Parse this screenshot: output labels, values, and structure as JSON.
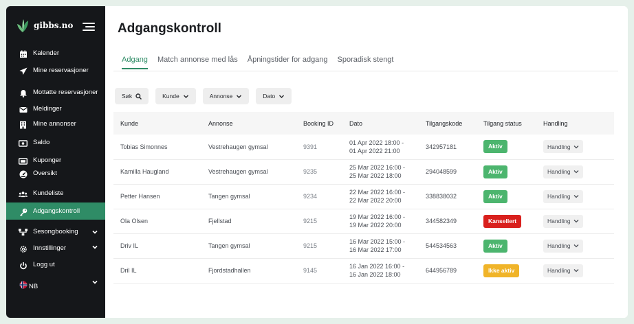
{
  "sidebar": {
    "brand": "gibbs.no",
    "items": [
      {
        "label": "Kalender",
        "icon": "calendar-icon"
      },
      {
        "label": "Mine reservasjoner",
        "icon": "paper-plane-icon"
      },
      {
        "label": "Mottatte reservasjoner",
        "icon": "bell-icon"
      },
      {
        "label": "Meldinger",
        "icon": "envelope-icon"
      },
      {
        "label": "Mine annonser",
        "icon": "building-icon"
      },
      {
        "label": "Saldo",
        "icon": "money-icon"
      },
      {
        "label": "Kuponger",
        "icon": "ticket-icon"
      },
      {
        "label": "Oversikt",
        "icon": "gauge-icon"
      },
      {
        "label": "Kundeliste",
        "icon": "users-icon"
      },
      {
        "label": "Adgangskontroll",
        "icon": "key-icon",
        "active": true
      },
      {
        "label": "Sesongbooking",
        "icon": "sitemap-icon",
        "expandable": true
      },
      {
        "label": "Innstillinger",
        "icon": "gear-icon",
        "expandable": true
      },
      {
        "label": "Logg ut",
        "icon": "power-icon"
      },
      {
        "label": "NB",
        "icon": "norway-flag-icon",
        "expandable": true
      }
    ]
  },
  "header": {
    "title": "Adgangskontroll"
  },
  "tabs": [
    {
      "label": "Adgang",
      "active": true
    },
    {
      "label": "Match annonse med lås"
    },
    {
      "label": "Åpningstider for adgang"
    },
    {
      "label": "Sporadisk stengt"
    }
  ],
  "filters": [
    {
      "label": "Søk",
      "icon": "search-icon"
    },
    {
      "label": "Kunde",
      "icon": "chevron-down-icon"
    },
    {
      "label": "Annonse",
      "icon": "chevron-down-icon"
    },
    {
      "label": "Dato",
      "icon": "chevron-down-icon"
    }
  ],
  "table": {
    "columns": [
      "Kunde",
      "Annonse",
      "Booking ID",
      "Dato",
      "Tilgangskode",
      "Tilgang status",
      "Handling"
    ],
    "rows": [
      {
        "kunde": "Tobias Simonnes",
        "annonse": "Vestrehaugen gymsal",
        "booking_id": "9391",
        "dato_from": "01 Apr 2022 18:00 -",
        "dato_to": "01 Apr 2022 21:00",
        "kode": "342957181",
        "status": "Aktiv",
        "status_color": "#4cb56e",
        "handling": "Handling"
      },
      {
        "kunde": "Kamilla Haugland",
        "annonse": "Vestrehaugen gymsal",
        "booking_id": "9235",
        "dato_from": "25 Mar 2022 16:00 -",
        "dato_to": "25 Mar 2022 18:00",
        "kode": "294048599",
        "status": "Aktiv",
        "status_color": "#4cb56e",
        "handling": "Handling"
      },
      {
        "kunde": "Petter Hansen",
        "annonse": "Tangen gymsal",
        "booking_id": "9234",
        "dato_from": "22 Mar 2022 16:00 -",
        "dato_to": "22 Mar 2022 20:00",
        "kode": "338838032",
        "status": "Aktiv",
        "status_color": "#4cb56e",
        "handling": "Handling"
      },
      {
        "kunde": "Ola Olsen",
        "annonse": "Fjellstad",
        "booking_id": "9215",
        "dato_from": "19 Mar 2022 16:00 -",
        "dato_to": "19 Mar 2022 20:00",
        "kode": "344582349",
        "status": "Kansellert",
        "status_color": "#d9201d",
        "handling": "Handling"
      },
      {
        "kunde": "Driv IL",
        "annonse": "Tangen gymsal",
        "booking_id": "9215",
        "dato_from": "16 Mar 2022 15:00 -",
        "dato_to": "16 Mar 2022 17:00",
        "kode": "544534563",
        "status": "Aktiv",
        "status_color": "#4cb56e",
        "handling": "Handling"
      },
      {
        "kunde": "Dril IL",
        "annonse": "Fjordstadhallen",
        "booking_id": "9145",
        "dato_from": "16 Jan 2022 16:00 -",
        "dato_to": "16 Jan 2022 18:00",
        "kode": "644956789",
        "status": "Ikke aktiv",
        "status_color": "#f0b429",
        "handling": "Handling"
      }
    ]
  },
  "colors": {
    "accent": "#2f8c66",
    "sidebar_bg": "#15171a"
  }
}
